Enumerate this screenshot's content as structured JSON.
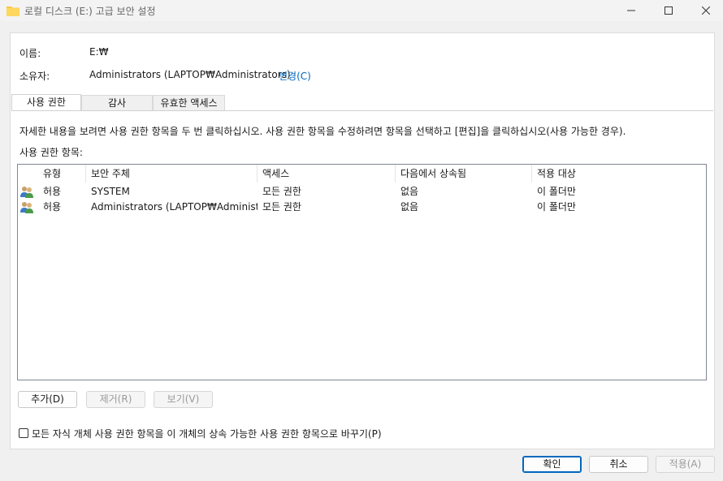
{
  "window": {
    "title": "로컬 디스크 (E:) 고급 보안 설정",
    "folder_icon": "folder-icon"
  },
  "info": {
    "name_label": "이름:",
    "name_value": "E:₩",
    "owner_label": "소유자:",
    "owner_value": "Administrators (LAPTOP₩Administrators)",
    "change_link": "변경(C)"
  },
  "tabs": [
    "사용 권한",
    "감사",
    "유효한 액세스"
  ],
  "permissions": {
    "description": "자세한 내용을 보려면 사용 권한 항목을 두 번 클릭하십시오. 사용 권한 항목을 수정하려면 항목을 선택하고 [편집]을 클릭하십시오(사용 가능한 경우).",
    "entries_label": "사용 권한 항목:",
    "columns": [
      "유형",
      "보안 주체",
      "액세스",
      "다음에서 상속됨",
      "적용 대상"
    ],
    "rows": [
      [
        "허용",
        "SYSTEM",
        "모든 권한",
        "없음",
        "이 폴더만"
      ],
      [
        "허용",
        "Administrators (LAPTOP₩Administr...",
        "모든 권한",
        "없음",
        "이 폴더만"
      ]
    ],
    "buttons": {
      "add": "추가(D)",
      "remove": "제거(R)",
      "view": "보기(V)"
    },
    "replace_checkbox": "모든 자식 개체 사용 권한 항목을 이 개체의 상속 가능한 사용 권한 항목으로 바꾸기(P)"
  },
  "footer": {
    "ok": "확인",
    "cancel": "취소",
    "apply": "적용(A)"
  }
}
